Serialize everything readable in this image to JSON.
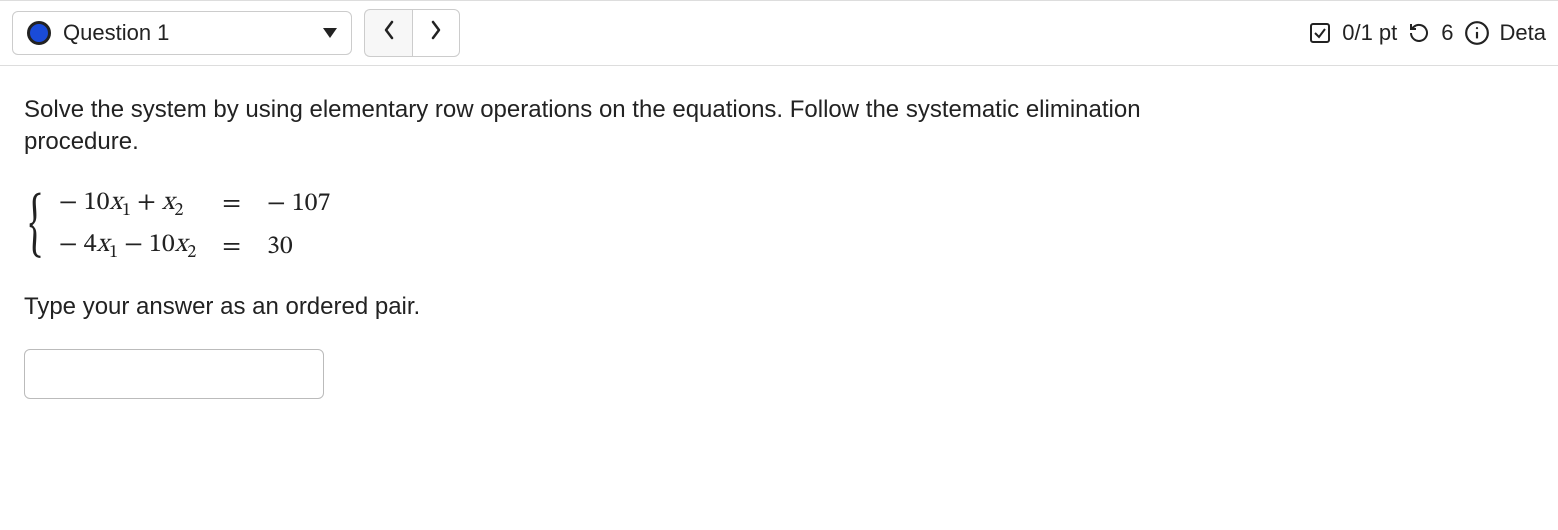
{
  "header": {
    "question_label": "Question 1",
    "points": "0/1 pt",
    "attempts": "6",
    "details_label": "Deta"
  },
  "body": {
    "prompt": "Solve the system by using elementary row operations on the equations. Follow the systematic elimination procedure.",
    "equations": [
      {
        "lhs": "− 10x₁ + x₂",
        "rhs": "− 107"
      },
      {
        "lhs": "− 4x₁ − 10x₂",
        "rhs": "30"
      }
    ],
    "instruction": "Type your answer as an ordered pair.",
    "answer_value": ""
  }
}
